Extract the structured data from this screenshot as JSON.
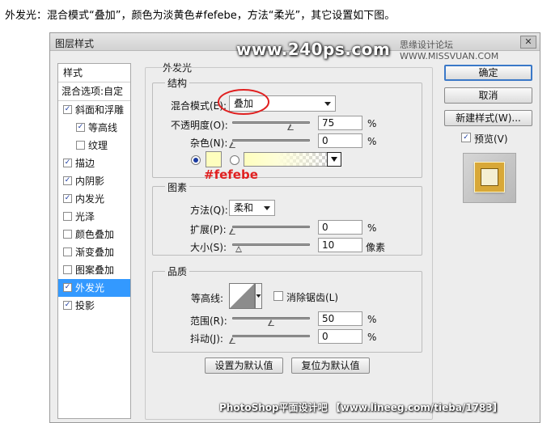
{
  "intro_text": "外发光：混合模式“叠加”，颜色为淡黄色#fefebe，方法“柔光”，其它设置如下图。",
  "dialog": {
    "title": "图层样式",
    "watermark_site": "www.240ps.com",
    "forum_watermark": "思缘设计论坛 WWW.MISSVUAN.COM",
    "close_glyph": "✕"
  },
  "styles_list": {
    "header": "样式",
    "blend_options": "混合选项:自定",
    "items": [
      {
        "label": "斜面和浮雕",
        "checked": true
      },
      {
        "label": "等高线",
        "checked": true
      },
      {
        "label": "纹理",
        "checked": false
      },
      {
        "label": "描边",
        "checked": true
      },
      {
        "label": "内阴影",
        "checked": true
      },
      {
        "label": "内发光",
        "checked": true
      },
      {
        "label": "光泽",
        "checked": false
      },
      {
        "label": "颜色叠加",
        "checked": false
      },
      {
        "label": "渐变叠加",
        "checked": false
      },
      {
        "label": "图案叠加",
        "checked": false
      },
      {
        "label": "外发光",
        "checked": true
      },
      {
        "label": "投影",
        "checked": true
      }
    ],
    "check_glyph": "✓"
  },
  "panel": {
    "title": "外发光",
    "structure": {
      "title": "结构",
      "blend_mode_label": "混合模式(E):",
      "blend_mode_value": "叠加",
      "opacity_label": "不透明度(O):",
      "opacity_value": "75",
      "opacity_percent": 75,
      "noise_label": "杂色(N):",
      "noise_value": "0",
      "noise_percent": 0,
      "percent": "%",
      "color_swatch": "#fefebe",
      "color_annotation": "#fefebe"
    },
    "elements": {
      "title": "图素",
      "method_label": "方法(Q):",
      "method_value": "柔和",
      "spread_label": "扩展(P):",
      "spread_value": "0",
      "spread_percent": 0,
      "size_label": "大小(S):",
      "size_value": "10",
      "size_fraction": 0.04,
      "size_unit": "像素",
      "percent": "%"
    },
    "quality": {
      "title": "品质",
      "contour_label": "等高线:",
      "antialias_label": "消除锯齿(L)",
      "range_label": "范围(R):",
      "range_value": "50",
      "range_percent": 50,
      "jitter_label": "抖动(J):",
      "jitter_value": "0",
      "jitter_percent": 0,
      "percent": "%"
    },
    "make_default": "设置为默认值",
    "reset_default": "复位为默认值"
  },
  "buttons": {
    "ok": "确定",
    "cancel": "取消",
    "new_style": "新建样式(W)...",
    "preview_label": "预览(V)"
  },
  "footer_watermark": "PhotoShop平面设计吧 【www.lineeg.com/tieba/1783】",
  "colors": {
    "selection": "#3399ff",
    "annotation_red": "#e02020",
    "accent_blue": "#3a78c8"
  }
}
